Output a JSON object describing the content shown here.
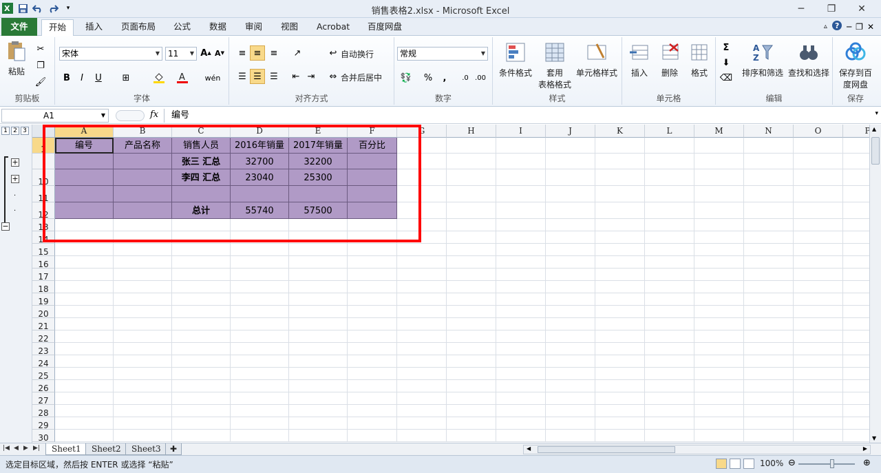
{
  "window": {
    "title": "销售表格2.xlsx - Microsoft Excel",
    "controls": [
      "─",
      "❐",
      "✕"
    ]
  },
  "tabs": [
    {
      "label": "文件",
      "key": "file"
    },
    {
      "label": "开始",
      "key": "home"
    },
    {
      "label": "插入",
      "key": "insert"
    },
    {
      "label": "页面布局",
      "key": "layout"
    },
    {
      "label": "公式",
      "key": "formulas"
    },
    {
      "label": "数据",
      "key": "data"
    },
    {
      "label": "审阅",
      "key": "review"
    },
    {
      "label": "视图",
      "key": "view"
    },
    {
      "label": "Acrobat",
      "key": "acrobat"
    },
    {
      "label": "百度网盘",
      "key": "baidu"
    }
  ],
  "ribbon": {
    "clipboard": {
      "label": "剪贴板",
      "paste": "粘贴"
    },
    "font": {
      "label": "字体",
      "family": "宋体",
      "size": "11"
    },
    "alignment": {
      "label": "对齐方式",
      "wrap": "自动换行",
      "merge": "合并后居中"
    },
    "number": {
      "label": "数字",
      "format": "常规"
    },
    "styles": {
      "label": "样式",
      "cond": "条件格式",
      "table1": "套用",
      "table2": "表格格式",
      "cell": "单元格样式"
    },
    "cells": {
      "label": "单元格",
      "insert": "插入",
      "delete": "删除",
      "format": "格式"
    },
    "editing": {
      "label": "编辑",
      "sort": "排序和筛选",
      "find": "查找和选择"
    },
    "save": {
      "label": "保存",
      "btn1": "保存到百",
      "btn2": "度网盘"
    }
  },
  "formula_bar": {
    "name_box": "A1",
    "fx": "fx",
    "content": "编号"
  },
  "outline": {
    "levels": [
      "1",
      "2",
      "3"
    ]
  },
  "columns": [
    "A",
    "B",
    "C",
    "D",
    "E",
    "F",
    "G",
    "H",
    "I",
    "J",
    "K",
    "L",
    "M",
    "N",
    "O",
    "P"
  ],
  "rows": [
    "1",
    "",
    "10",
    "11",
    "12",
    "13",
    "14",
    "15",
    "16",
    "17",
    "18",
    "19",
    "20",
    "21",
    "22",
    "23",
    "24",
    "25",
    "26",
    "27",
    "28",
    "29",
    "30"
  ],
  "table": {
    "headers": [
      "编号",
      "产品名称",
      "销售人员",
      "2016年销量",
      "2017年销量",
      "百分比"
    ],
    "rows": [
      [
        "",
        "",
        "张三  汇总",
        "32700",
        "32200",
        ""
      ],
      [
        "",
        "",
        "李四  汇总",
        "23040",
        "25300",
        ""
      ],
      [
        "",
        "",
        "",
        "",
        "",
        ""
      ],
      [
        "",
        "",
        "总计",
        "55740",
        "57500",
        ""
      ]
    ]
  },
  "sheets": [
    "Sheet1",
    "Sheet2",
    "Sheet3"
  ],
  "status": {
    "message": "选定目标区域，然后按 ENTER 或选择 “粘贴”",
    "zoom": "100%"
  },
  "colors": {
    "table_fill": "#b09ac6",
    "highlight_box": "#ff0000",
    "file_tab": "#2a7a37"
  }
}
